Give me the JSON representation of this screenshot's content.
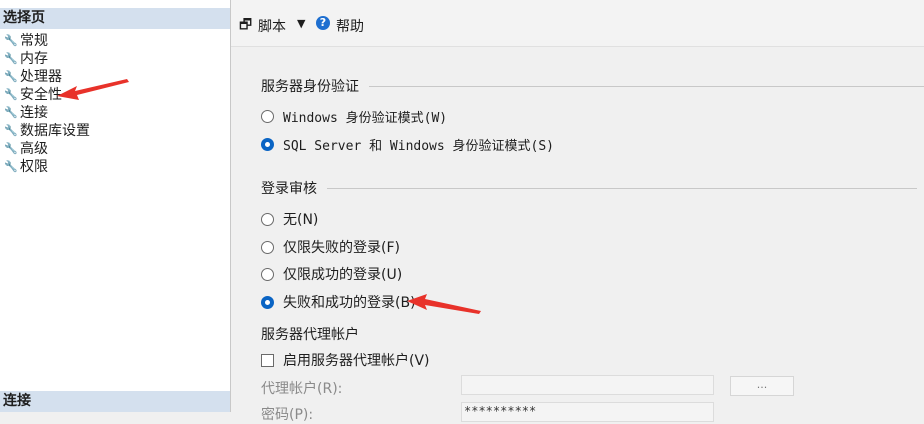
{
  "left_pane": {
    "header": "选择页",
    "items": [
      {
        "label": "常规"
      },
      {
        "label": "内存"
      },
      {
        "label": "处理器"
      },
      {
        "label": "安全性"
      },
      {
        "label": "连接"
      },
      {
        "label": "数据库设置"
      },
      {
        "label": "高级"
      },
      {
        "label": "权限"
      }
    ],
    "bottom_header": "连接"
  },
  "toolbar": {
    "script_label": "脚本",
    "help_label": "帮助",
    "help_icon_glyph": "?",
    "script_icon_glyph": "🗗"
  },
  "server_auth": {
    "title": "服务器身份验证",
    "options": [
      {
        "label": "Windows 身份验证模式(W)",
        "selected": false
      },
      {
        "label": "SQL Server 和 Windows 身份验证模式(S)",
        "selected": true
      }
    ]
  },
  "login_audit": {
    "title": "登录审核",
    "options": [
      {
        "label": "无(N)",
        "selected": false
      },
      {
        "label": "仅限失败的登录(F)",
        "selected": false
      },
      {
        "label": "仅限成功的登录(U)",
        "selected": false
      },
      {
        "label": "失败和成功的登录(B)",
        "selected": true
      }
    ]
  },
  "proxy": {
    "title": "服务器代理帐户",
    "enable_label": "启用服务器代理帐户(V)",
    "enabled": false,
    "account_label": "代理帐户(R):",
    "account_value": "",
    "password_label": "密码(P):",
    "password_value": "**********",
    "browse_label": "..."
  },
  "colors": {
    "header_bg": "#d4e0ee",
    "accent": "#0a64c4",
    "arrow": "#e8322a"
  }
}
